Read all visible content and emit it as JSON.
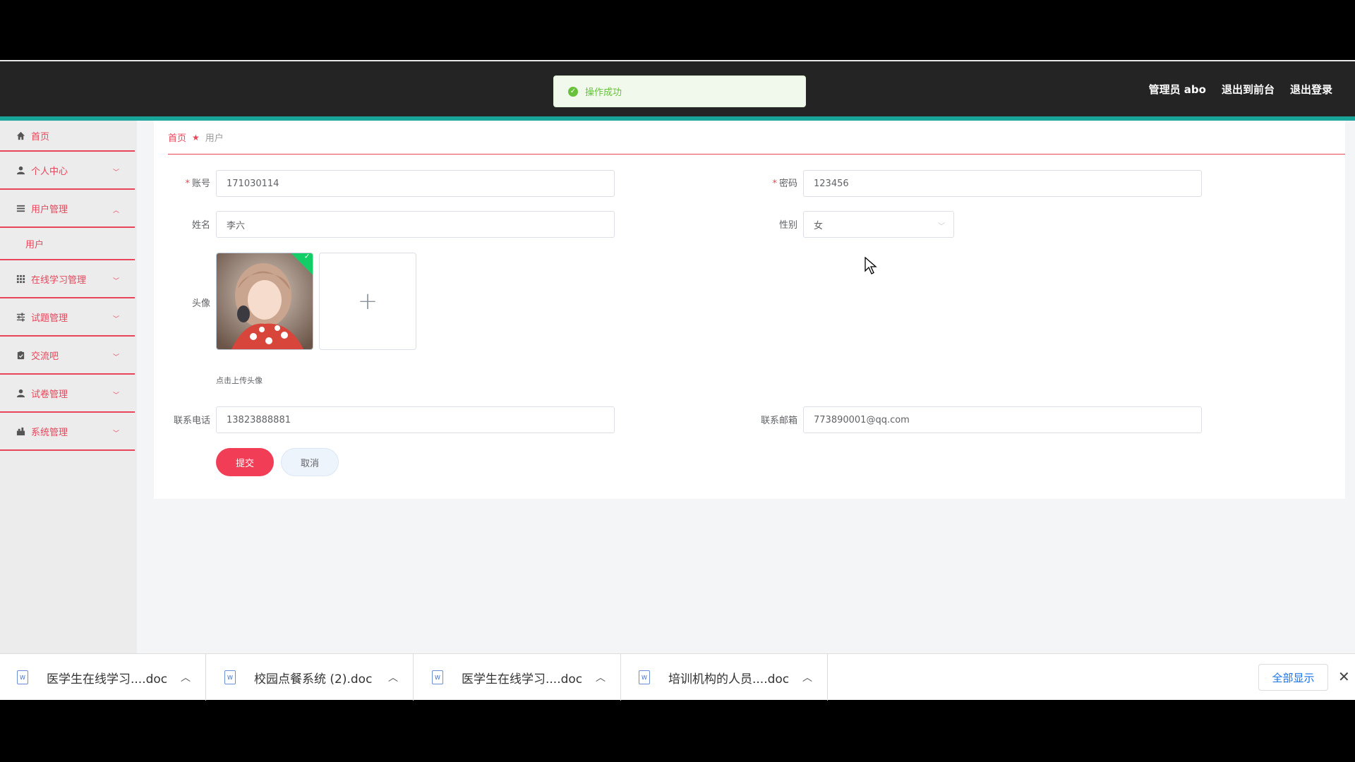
{
  "header": {
    "user_label": "管理员 abo",
    "to_front": "退出到前台",
    "logout": "退出登录"
  },
  "toast": {
    "message": "操作成功",
    "color": "#67c23a"
  },
  "sidebar": {
    "items": [
      {
        "label": "首页",
        "icon": "home-icon"
      },
      {
        "label": "个人中心",
        "icon": "user-icon"
      },
      {
        "label": "用户管理",
        "icon": "list-icon",
        "expanded": true
      },
      {
        "label": "用户",
        "sub": true
      },
      {
        "label": "在线学习管理",
        "icon": "grid-icon"
      },
      {
        "label": "试题管理",
        "icon": "sliders-icon"
      },
      {
        "label": "交流吧",
        "icon": "clipboard-icon"
      },
      {
        "label": "试卷管理",
        "icon": "user-icon"
      },
      {
        "label": "系统管理",
        "icon": "gear-icon"
      }
    ],
    "accent": "#e9455a"
  },
  "breadcrumb": {
    "home": "首页",
    "current": "用户"
  },
  "form": {
    "account": {
      "label": "账号",
      "value": "171030114"
    },
    "password": {
      "label": "密码",
      "value": "123456"
    },
    "name": {
      "label": "姓名",
      "value": "李六"
    },
    "gender": {
      "label": "性别",
      "value": "女"
    },
    "avatar": {
      "label": "头像",
      "hint": "点击上传头像"
    },
    "phone": {
      "label": "联系电话",
      "value": "13823888881"
    },
    "email": {
      "label": "联系邮箱",
      "value": "773890001@qq.com"
    },
    "submit": "提交",
    "cancel": "取消"
  },
  "downloads": {
    "items": [
      "医学生在线学习....doc",
      "校园点餐系统 (2).doc",
      "医学生在线学习....doc",
      "培训机构的人员....doc"
    ],
    "show_all": "全部显示"
  }
}
